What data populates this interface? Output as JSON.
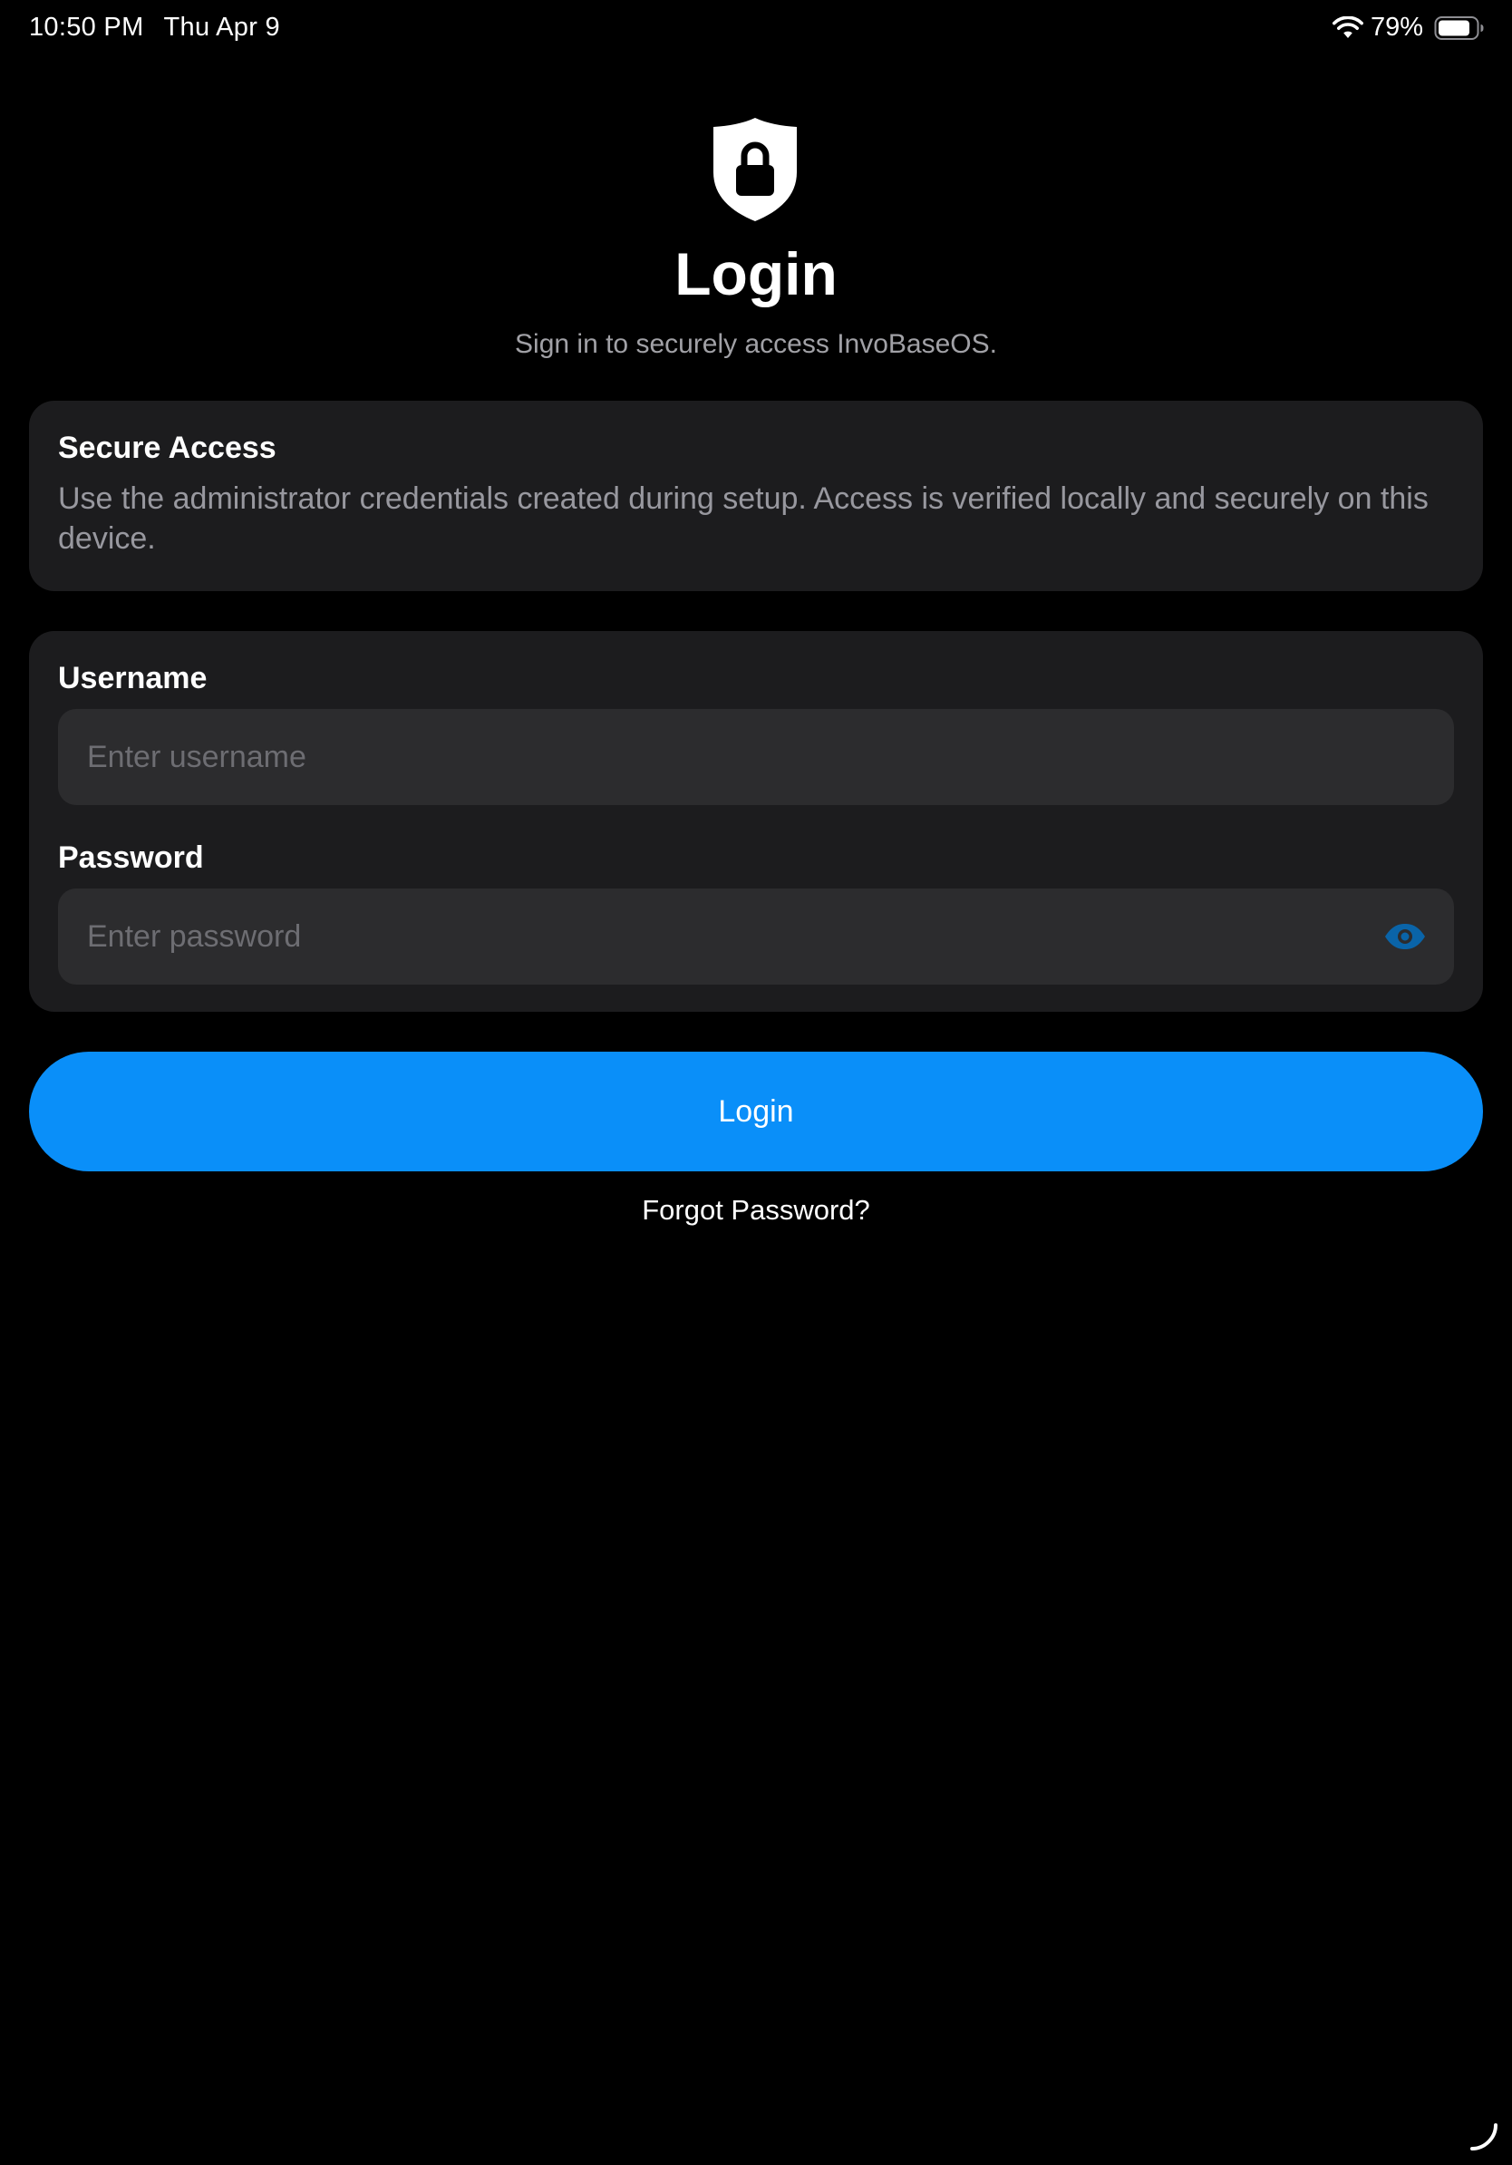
{
  "status_bar": {
    "time": "10:50 PM",
    "date": "Thu Apr 9",
    "battery": "79%",
    "icons": [
      "wifi-icon",
      "battery-icon"
    ]
  },
  "header": {
    "icon": "lock-shield-icon",
    "title": "Login",
    "subtitle": "Sign in to securely access InvoBaseOS."
  },
  "info_card": {
    "title": "Secure Access",
    "text": "Use the administrator credentials created during setup. Access is verified locally and securely on this device."
  },
  "form": {
    "username": {
      "label": "Username",
      "value": "",
      "placeholder": "Enter username"
    },
    "password": {
      "label": "Password",
      "value": "",
      "placeholder": "Enter password",
      "toggle_icon": "eye-icon"
    }
  },
  "actions": {
    "login_label": "Login",
    "forgot_label": "Forgot Password?"
  },
  "colors": {
    "background": "#000000",
    "card": "#1c1c1e",
    "input": "#2c2c2e",
    "accent": "#0a8ff9",
    "eye_icon": "#0a64a8",
    "secondary_text": "#98989f"
  }
}
